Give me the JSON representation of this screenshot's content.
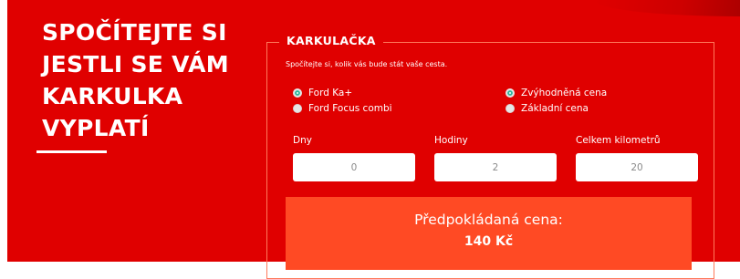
{
  "colors": {
    "background": "#e00000",
    "result_panel": "#ff4a24",
    "fieldset_border": "#ff7a5c",
    "radio_checked": "#2fb59c",
    "text": "#ffffff"
  },
  "headline": {
    "lines": [
      "SPOČÍTEJTE SI",
      "JESTLI SE VÁM",
      "KARKULKA",
      "VYPLATÍ"
    ]
  },
  "calculator": {
    "title": "KARKULAČKA",
    "subtitle": "Spočítejte si, kolik vás bude stát vaše cesta.",
    "car_options": [
      {
        "label": "Ford Ka+",
        "checked": true,
        "icon": "radio-checked-icon"
      },
      {
        "label": "Ford Focus combi",
        "checked": false,
        "icon": "radio-unchecked-icon"
      }
    ],
    "price_options": [
      {
        "label": "Zvýhodněná cena",
        "checked": true,
        "icon": "radio-checked-icon"
      },
      {
        "label": "Základní cena",
        "checked": false,
        "icon": "radio-unchecked-icon"
      }
    ],
    "fields": {
      "days": {
        "label": "Dny",
        "value": "0"
      },
      "hours": {
        "label": "Hodiny",
        "value": "2"
      },
      "kilometers": {
        "label": "Celkem kilometrů",
        "value": "20"
      }
    },
    "result": {
      "label": "Předpokládaná cena:",
      "value": "140 Kč"
    }
  }
}
